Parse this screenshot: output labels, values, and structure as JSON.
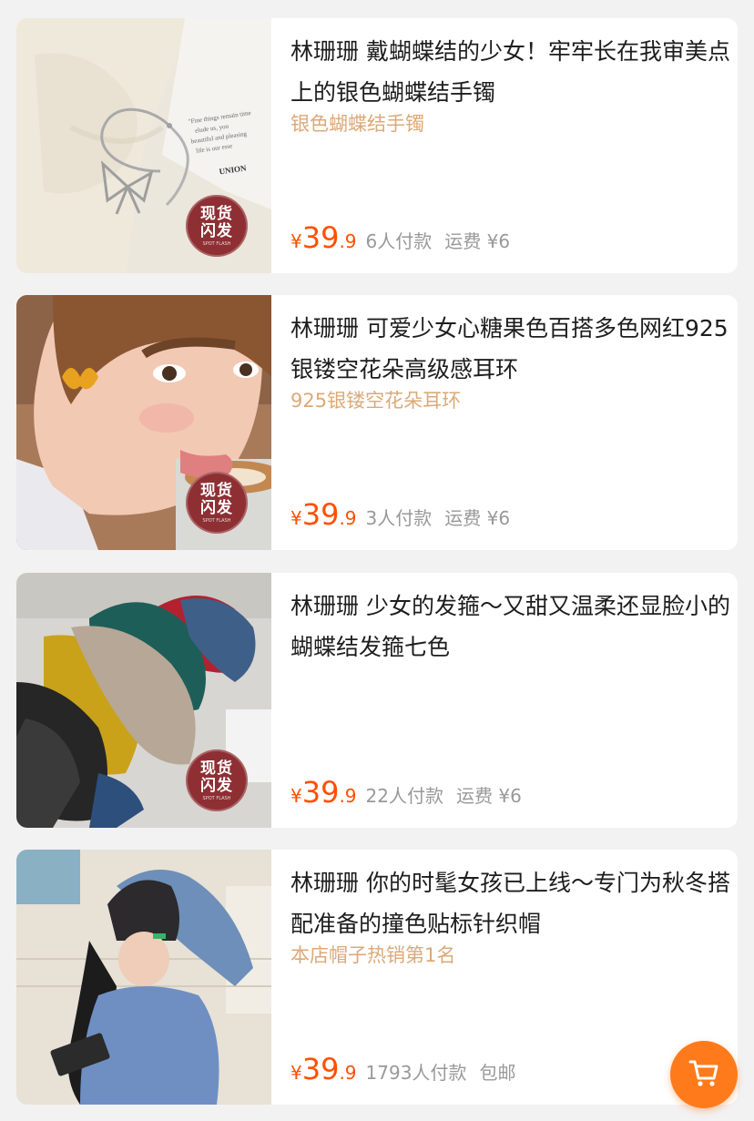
{
  "products": [
    {
      "title": "林珊珊 戴蝴蝶结的少女！牢牢长在我审美点上的银色蝴蝶结手镯",
      "subtitle": "银色蝴蝶结手镯",
      "price_symbol": "¥",
      "price_int": "39",
      "price_dec": ".9",
      "buyers": "6人付款",
      "shipping": "运费 ¥6",
      "badge_text_1": "现货",
      "badge_text_2": "闪发",
      "badge_small": "SPOT FLASH",
      "image_text_1": "\"Fine things remain time",
      "image_text_2": "elude us, you",
      "image_text_3": "beautiful and pleasing",
      "image_text_4": "life is our esse",
      "image_text_5": "UNION"
    },
    {
      "title": "林珊珊 可爱少女心糖果色百搭多色网红925银镂空花朵高级感耳环",
      "subtitle": "925银镂空花朵耳环",
      "price_symbol": "¥",
      "price_int": "39",
      "price_dec": ".9",
      "buyers": "3人付款",
      "shipping": "运费 ¥6",
      "badge_text_1": "现货",
      "badge_text_2": "闪发",
      "badge_small": "SPOT FLASH"
    },
    {
      "title": "林珊珊 少女的发箍～又甜又温柔还显脸小的蝴蝶结发箍七色",
      "subtitle": "",
      "price_symbol": "¥",
      "price_int": "39",
      "price_dec": ".9",
      "buyers": "22人付款",
      "shipping": "运费 ¥6",
      "badge_text_1": "现货",
      "badge_text_2": "闪发",
      "badge_small": "SPOT FLASH"
    },
    {
      "title": "林珊珊 你的时髦女孩已上线～专门为秋冬搭配准备的撞色贴标针织帽",
      "subtitle": "本店帽子热销第1名",
      "price_symbol": "¥",
      "price_int": "39",
      "price_dec": ".9",
      "buyers": "1793人付款",
      "shipping": "包邮"
    }
  ],
  "colors": {
    "price": "#ff5000",
    "subtitle": "#dca978",
    "badge": "#8e2f33",
    "cart_button": "#ff7a1a"
  },
  "icons": {
    "cart": "shopping-cart-icon"
  }
}
